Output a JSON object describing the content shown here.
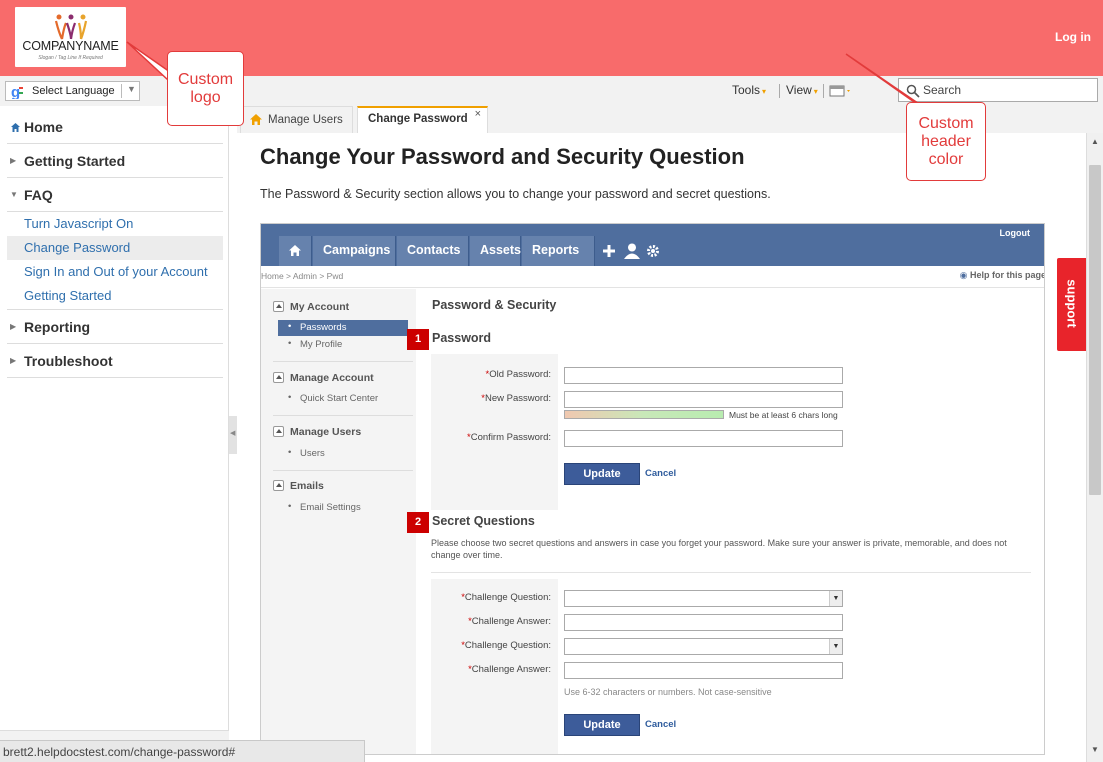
{
  "header": {
    "logo_name": "COMPANYNAME",
    "logo_tagline": "Slogan / Tag Line If Required",
    "login_label": "Log in",
    "color": "#f86b6b"
  },
  "toolbar": {
    "language_label": "Select Language",
    "tools_label": "Tools",
    "view_label": "View",
    "search_placeholder": "Search"
  },
  "sidebar": {
    "items": [
      {
        "label": "Home",
        "type": "top"
      },
      {
        "label": "Getting Started",
        "type": "top"
      },
      {
        "label": "FAQ",
        "type": "top"
      },
      {
        "label": "Turn Javascript On",
        "type": "sub"
      },
      {
        "label": "Change Password",
        "type": "sub",
        "active": true
      },
      {
        "label": "Sign In and Out of your Account",
        "type": "sub"
      },
      {
        "label": "Getting Started",
        "type": "sub"
      },
      {
        "label": "Reporting",
        "type": "top"
      },
      {
        "label": "Troubleshoot",
        "type": "top"
      }
    ]
  },
  "tabs": [
    {
      "label": "Manage Users"
    },
    {
      "label": "Change Password",
      "active": true,
      "close": "×"
    }
  ],
  "article": {
    "title": "Change Your Password and Security Question",
    "intro": "The Password & Security section allows you to change your password and secret questions."
  },
  "screenshot": {
    "logout": "Logout",
    "nav_tabs": [
      "Campaigns",
      "Contacts",
      "Assets",
      "Reports"
    ],
    "breadcrumb": "Home > Admin > Pwd",
    "help": "Help for this page",
    "left_sections": [
      {
        "title": "My Account",
        "items": [
          "Passwords",
          "My Profile"
        ]
      },
      {
        "title": "Manage Account",
        "items": [
          "Quick Start Center"
        ]
      },
      {
        "title": "Manage Users",
        "items": [
          "Users"
        ]
      },
      {
        "title": "Emails",
        "items": [
          "Email Settings"
        ]
      }
    ],
    "section_title": "Password & Security",
    "password": {
      "badge": "1",
      "title": "Password",
      "old_label": "Old Password:",
      "new_label": "New Password:",
      "hint": "Must be at least 6 chars long",
      "confirm_label": "Confirm Password:",
      "update": "Update",
      "cancel": "Cancel"
    },
    "secret": {
      "badge": "2",
      "title": "Secret Questions",
      "desc": "Please choose two secret questions and answers in case you forget your password. Make sure your answer is private, memorable, and does not change over time.",
      "q_label": "Challenge Question:",
      "a_label": "Challenge Answer:",
      "hint": "Use 6-32 characters or numbers. Not case-sensitive",
      "update": "Update",
      "cancel": "Cancel"
    }
  },
  "support_label": "support",
  "callouts": {
    "logo": "Custom logo",
    "header": "Custom header color"
  },
  "status_url": "brett2.helpdocstest.com/change-password#"
}
